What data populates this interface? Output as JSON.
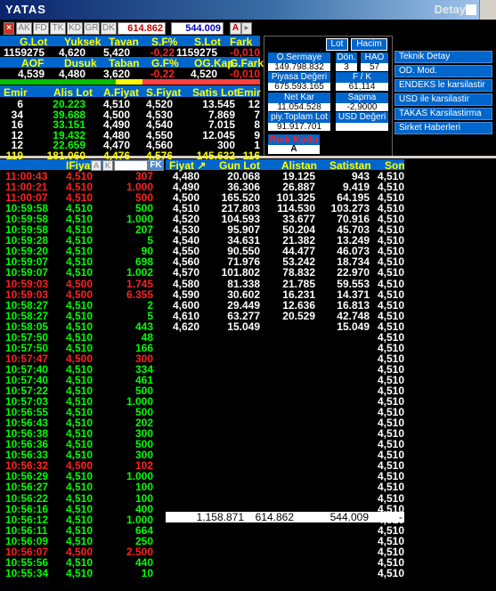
{
  "window": {
    "symbol": "YATAS",
    "detail_label": "Detay"
  },
  "toolbar": {
    "tabs": [
      "AK",
      "FD",
      "TK",
      "KD",
      "GR",
      "DK"
    ],
    "box1_value": "614.862",
    "box2_value": "544.009",
    "a_button": "A"
  },
  "summary": {
    "headers1": [
      "G.Lot",
      "Yuksek",
      "Tavan",
      "S.F%",
      "S.Lot",
      "Fark"
    ],
    "values1": [
      "1159275",
      "4,620",
      "5,420",
      "-0,22",
      "1159275",
      "-0,010"
    ],
    "headers2": [
      "AOF",
      "Dusuk",
      "Taban",
      "G.F%",
      "OG.Kap.",
      "G.Fark"
    ],
    "values2": [
      "4,539",
      "4,480",
      "3,620",
      "-0,22",
      "4,520",
      "-0,010"
    ]
  },
  "depth": {
    "headers": [
      "Emir",
      "Alis Lot",
      "A.Fiyat",
      "S.Fiyat",
      "Satis Lot",
      "Emir"
    ],
    "rows": [
      [
        "6",
        "20.223",
        "4,510",
        "4,520",
        "13.545",
        "12"
      ],
      [
        "34",
        "39.688",
        "4,500",
        "4,530",
        "7.869",
        "7"
      ],
      [
        "16",
        "33.151",
        "4,490",
        "4,540",
        "7.015",
        "8"
      ],
      [
        "12",
        "19.432",
        "4,480",
        "4,550",
        "12.045",
        "9"
      ],
      [
        "12",
        "22.659",
        "4,470",
        "4,560",
        "300",
        "1"
      ]
    ],
    "totals": [
      "119",
      "181.060",
      "4,476",
      "4,576",
      "145.632",
      "116"
    ]
  },
  "info_panel": {
    "lot_button": "Lot",
    "hacim_button": "Hacim",
    "o_sermaye_label": "O.Sermaye",
    "o_sermaye_value": "149.798.832",
    "don_label": "Dön.",
    "don_value": "3",
    "hao_label": "HAO",
    "hao_value": "57",
    "piyasa_label": "Piyasa Değeri",
    "piyasa_value": "675.593.165",
    "fk_label": "F / K",
    "fk_value": "61,114",
    "net_kar_label": "Net Kar",
    "net_kar_value": "11.054.528",
    "sapma_label": "Sapma",
    "sapma_value": "-2,9000",
    "piy_toplam_label": "piy.Toplam Lot",
    "piy_toplam_value": "91.917.701",
    "usd_label": "USD Değeri",
    "risk_kodu_label": "Risk Kodu",
    "risk_kodu_value": "A"
  },
  "side_menu": [
    "Teknik Detay",
    "OD. Mod.",
    "ENDEKS le karsilastir",
    "USD ile karsilastir",
    "TAKAS Karsilastirma",
    "Sirket Haberleri"
  ],
  "trades": {
    "headers": [
      "IFiyat",
      "FK"
    ],
    "sub_buttons": [
      "A",
      "K"
    ],
    "rows": [
      [
        "11:00:43",
        "4,510",
        "307",
        "r"
      ],
      [
        "11:00:21",
        "4,510",
        "1.000",
        "r"
      ],
      [
        "11:00:07",
        "4,510",
        "500",
        "r"
      ],
      [
        "10:59:58",
        "4,510",
        "500",
        "g"
      ],
      [
        "10:59:58",
        "4,510",
        "1.000",
        "g"
      ],
      [
        "10:59:58",
        "4,510",
        "207",
        "g"
      ],
      [
        "10:59:28",
        "4,510",
        "5",
        "g"
      ],
      [
        "10:59:20",
        "4,510",
        "90",
        "g"
      ],
      [
        "10:59:07",
        "4,510",
        "698",
        "g"
      ],
      [
        "10:59:07",
        "4,510",
        "1.002",
        "g"
      ],
      [
        "10:59:03",
        "4,500",
        "1.745",
        "r"
      ],
      [
        "10:59:03",
        "4,500",
        "6.355",
        "r"
      ],
      [
        "10:58:27",
        "4,510",
        "2",
        "g"
      ],
      [
        "10:58:27",
        "4,510",
        "5",
        "g"
      ],
      [
        "10:58:05",
        "4,510",
        "443",
        "g"
      ],
      [
        "10:57:50",
        "4,510",
        "48",
        "g"
      ],
      [
        "10:57:50",
        "4,510",
        "166",
        "g"
      ],
      [
        "10:57:47",
        "4,500",
        "300",
        "r"
      ],
      [
        "10:57:40",
        "4,510",
        "334",
        "g"
      ],
      [
        "10:57:40",
        "4,510",
        "461",
        "g"
      ],
      [
        "10:57:22",
        "4,510",
        "500",
        "g"
      ],
      [
        "10:57:03",
        "4,510",
        "1.000",
        "g"
      ],
      [
        "10:56:55",
        "4,510",
        "500",
        "g"
      ],
      [
        "10:56:43",
        "4,510",
        "202",
        "g"
      ],
      [
        "10:56:38",
        "4,510",
        "300",
        "g"
      ],
      [
        "10:56:36",
        "4,510",
        "500",
        "g"
      ],
      [
        "10:56:33",
        "4,510",
        "300",
        "g"
      ],
      [
        "10:56:32",
        "4,500",
        "102",
        "r"
      ],
      [
        "10:56:29",
        "4,510",
        "1.000",
        "g"
      ],
      [
        "10:56:27",
        "4,510",
        "100",
        "g"
      ],
      [
        "10:56:22",
        "4,510",
        "100",
        "g"
      ],
      [
        "10:56:16",
        "4,510",
        "400",
        "g"
      ],
      [
        "10:56:12",
        "4,510",
        "1.000",
        "g"
      ],
      [
        "10:56:11",
        "4,510",
        "664",
        "g"
      ],
      [
        "10:56:09",
        "4,510",
        "250",
        "g"
      ],
      [
        "10:56:07",
        "4,500",
        "2.500",
        "r"
      ],
      [
        "10:55:56",
        "4,510",
        "440",
        "g"
      ],
      [
        "10:55:34",
        "4,510",
        "10",
        "g"
      ]
    ]
  },
  "price_dist": {
    "headers": [
      "Fiyat",
      "Gun Lot",
      "Alistan",
      "Satistan",
      "Son"
    ],
    "rows": [
      [
        "4,480",
        "20.068",
        "19.125",
        "943",
        "4,510"
      ],
      [
        "4,490",
        "36.306",
        "26.887",
        "9.419",
        "4,510"
      ],
      [
        "4,500",
        "165.520",
        "101.325",
        "64.195",
        "4,510"
      ],
      [
        "4,510",
        "217.803",
        "114.530",
        "103.273",
        "4,510"
      ],
      [
        "4,520",
        "104.593",
        "33.677",
        "70.916",
        "4,510"
      ],
      [
        "4,530",
        "95.907",
        "50.204",
        "45.703",
        "4,510"
      ],
      [
        "4,540",
        "34.631",
        "21.382",
        "13.249",
        "4,510"
      ],
      [
        "4,550",
        "90.550",
        "44.477",
        "46.073",
        "4,510"
      ],
      [
        "4,560",
        "71.976",
        "53.242",
        "18.734",
        "4,510"
      ],
      [
        "4,570",
        "101.802",
        "78.832",
        "22.970",
        "4,510"
      ],
      [
        "4,580",
        "81.338",
        "21.785",
        "59.553",
        "4,510"
      ],
      [
        "4,590",
        "30.602",
        "16.231",
        "14.371",
        "4,510"
      ],
      [
        "4,600",
        "29.449",
        "12.636",
        "16.813",
        "4,510"
      ],
      [
        "4,610",
        "63.277",
        "20.529",
        "42.748",
        "4,510"
      ],
      [
        "4,620",
        "15.049",
        "",
        "15.049",
        "4,510"
      ]
    ],
    "totals": [
      "1.158.871",
      "614.862",
      "544.009",
      "-"
    ],
    "son_column": [
      "4,510",
      "4,510",
      "4,510",
      "4,510",
      "4,510",
      "4,510",
      "4,510",
      "4,510",
      "4,510",
      "4,510",
      "4,510",
      "4,510",
      "4,510",
      "4,510",
      "4,510",
      "4,510",
      "4,510",
      "4,510",
      "4,510",
      "4,510",
      "4,510",
      "4,510",
      "4,510",
      "4,510",
      "4,510",
      "4,510",
      "4,510",
      "4,510",
      "4,510",
      "4,510",
      "4,510",
      "4,510",
      "4,510",
      "4,510",
      "4,510",
      "4,510",
      "4,510",
      "4,510"
    ]
  },
  "colors": {
    "up": "#00ff00",
    "down": "#ff2020",
    "header": "#ffff00",
    "accent": "#0066cc"
  }
}
